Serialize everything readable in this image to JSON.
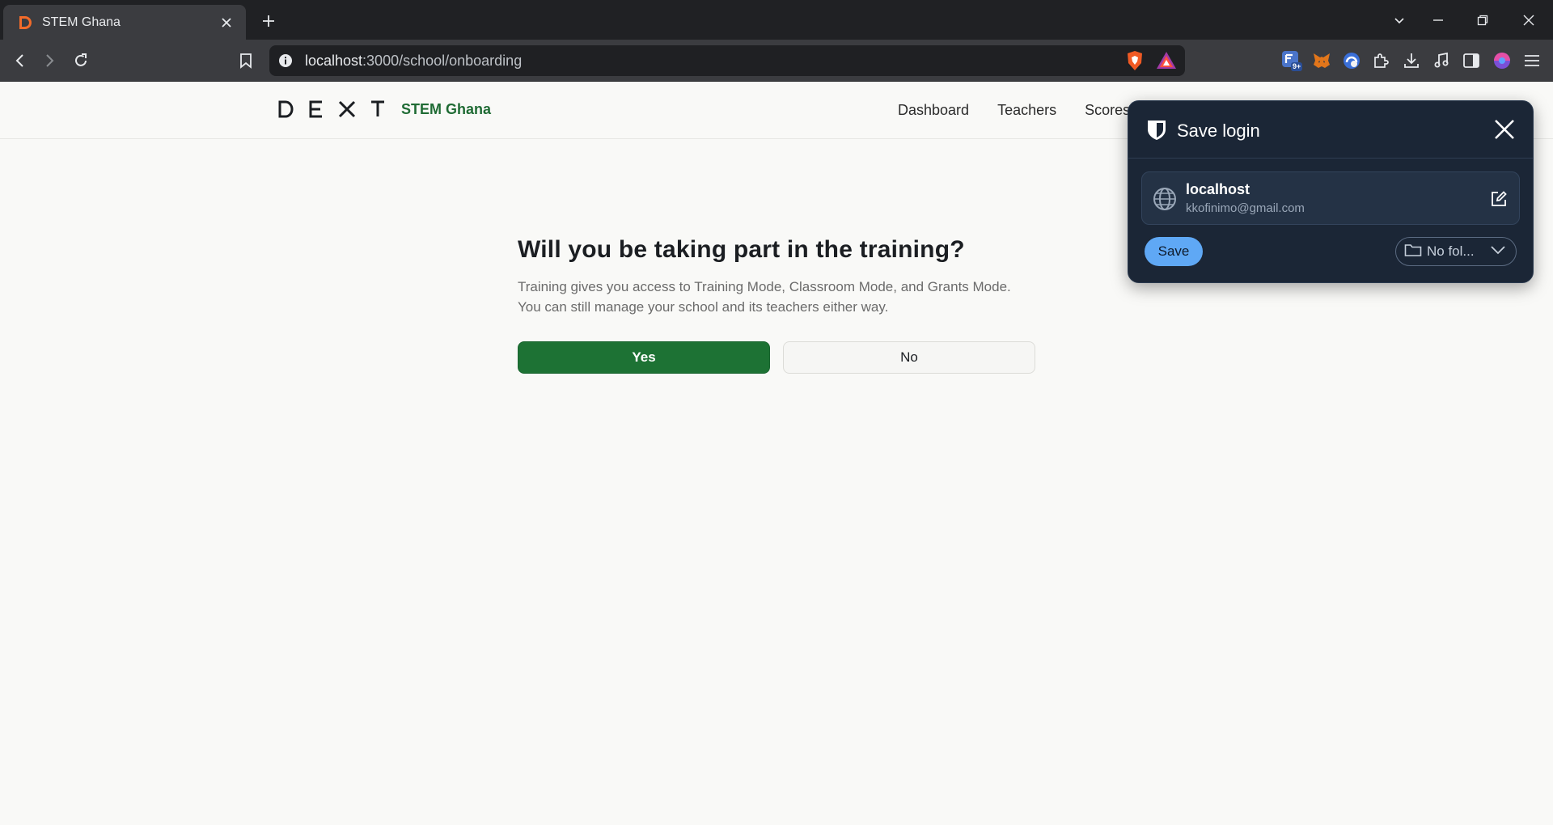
{
  "browser": {
    "tab_title": "STEM Ghana",
    "url_host": "localhost",
    "url_path": ":3000/school/onboarding",
    "extension_badge": "9+"
  },
  "site": {
    "logo_letters": [
      "D",
      "E",
      "X",
      "T"
    ],
    "logo_sub": "STEM Ghana",
    "brand_color": "#1d7234",
    "nav": [
      "Dashboard",
      "Teachers",
      "Scores"
    ]
  },
  "onboarding": {
    "heading": "Will you be taking part in the training?",
    "desc_line1": "Training gives you access to Training Mode, Classroom Mode, and Grants Mode.",
    "desc_line2": "You can still manage your school and its teachers either way.",
    "yes_label": "Yes",
    "no_label": "No"
  },
  "save_login": {
    "title": "Save login",
    "site": "localhost",
    "username": "kkofinimo@gmail.com",
    "save_label": "Save",
    "folder_label": "No fol..."
  }
}
